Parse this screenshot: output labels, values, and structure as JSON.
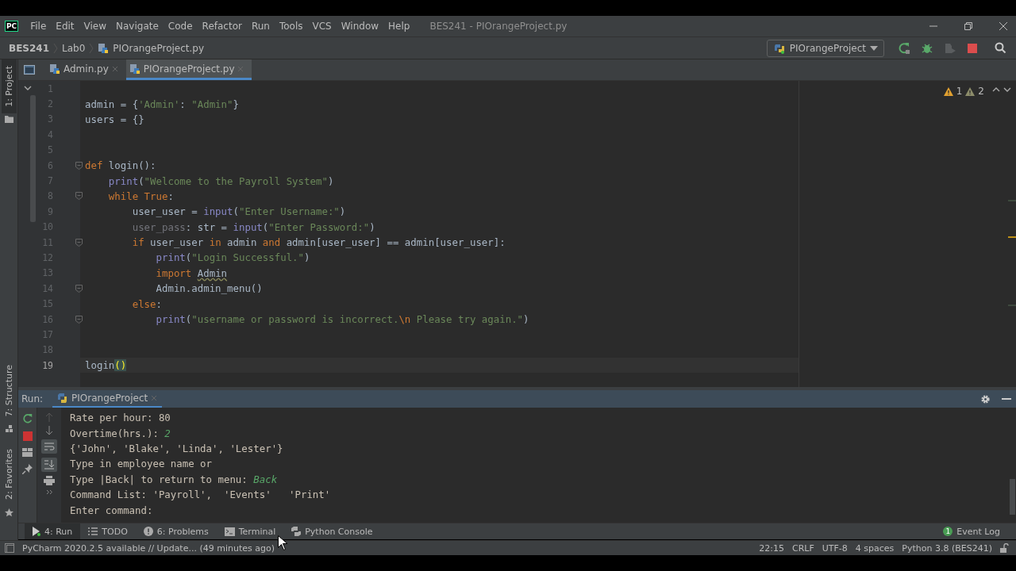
{
  "menu_bar": {
    "logo": "PC",
    "items": [
      "File",
      "Edit",
      "View",
      "Navigate",
      "Code",
      "Refactor",
      "Run",
      "Tools",
      "VCS",
      "Window",
      "Help"
    ],
    "title": "BES241 - PIOrangeProject.py"
  },
  "breadcrumbs": [
    "BES241",
    "Lab0",
    "PIOrangeProject.py"
  ],
  "run_config": {
    "label": "PIOrangeProject"
  },
  "side_tools": {
    "project": "1: Project",
    "structure": "7: Structure",
    "favorites": "2: Favorites"
  },
  "tabs": [
    {
      "label": "Admin.py",
      "selected": false
    },
    {
      "label": "PIOrangeProject.py",
      "selected": true
    }
  ],
  "inspections": {
    "warnings": "1",
    "weak_warnings": "2"
  },
  "editor": {
    "lines": [
      {
        "number": "1"
      },
      {
        "number": "2",
        "tokens": [
          {
            "kind": "plain",
            "text": "admin = {"
          },
          {
            "kind": "str",
            "text": "'Admin'"
          },
          {
            "kind": "plain",
            "text": ": "
          },
          {
            "kind": "str",
            "text": "\"Admin\""
          },
          {
            "kind": "plain",
            "text": "}"
          }
        ]
      },
      {
        "number": "3",
        "tokens": [
          {
            "kind": "plain",
            "text": "users = {}"
          }
        ]
      },
      {
        "number": "4"
      },
      {
        "number": "5"
      },
      {
        "number": "6",
        "fold": true,
        "tokens": [
          {
            "kind": "kw",
            "text": "def"
          },
          {
            "kind": "plain",
            "text": " login():"
          }
        ]
      },
      {
        "number": "7",
        "tokens": [
          {
            "kind": "builtin",
            "text": "    print"
          },
          {
            "kind": "plain",
            "text": "("
          },
          {
            "kind": "str",
            "text": "\"Welcome to the Payroll System\""
          },
          {
            "kind": "plain",
            "text": ")"
          }
        ]
      },
      {
        "number": "8",
        "fold": true,
        "tokens": [
          {
            "kind": "kw",
            "text": "    while True"
          },
          {
            "kind": "plain",
            "text": ":"
          }
        ]
      },
      {
        "number": "9",
        "tokens": [
          {
            "kind": "plain",
            "text": "        user_user = "
          },
          {
            "kind": "builtin",
            "text": "input"
          },
          {
            "kind": "plain",
            "text": "("
          },
          {
            "kind": "str",
            "text": "\"Enter Username:\""
          },
          {
            "kind": "plain",
            "text": ")"
          }
        ]
      },
      {
        "number": "10",
        "tokens": [
          {
            "kind": "dim",
            "text": "        user_pass"
          },
          {
            "kind": "plain",
            "text": ": str = "
          },
          {
            "kind": "builtin",
            "text": "input"
          },
          {
            "kind": "plain",
            "text": "("
          },
          {
            "kind": "str",
            "text": "\"Enter Password:\""
          },
          {
            "kind": "plain",
            "text": ")"
          }
        ]
      },
      {
        "number": "11",
        "fold": true,
        "tokens": [
          {
            "kind": "kw",
            "text": "        if"
          },
          {
            "kind": "plain",
            "text": " user_user "
          },
          {
            "kind": "kw",
            "text": "in"
          },
          {
            "kind": "plain",
            "text": " admin "
          },
          {
            "kind": "kw",
            "text": "and"
          },
          {
            "kind": "plain",
            "text": " admin[user_user] == admin[user_user]:"
          }
        ]
      },
      {
        "number": "12",
        "tokens": [
          {
            "kind": "builtin",
            "text": "            print"
          },
          {
            "kind": "plain",
            "text": "("
          },
          {
            "kind": "str",
            "text": "\"Login Successful.\""
          },
          {
            "kind": "plain",
            "text": ")"
          }
        ]
      },
      {
        "number": "13",
        "tokens": [
          {
            "kind": "kw",
            "text": "            import "
          },
          {
            "kind": "warn",
            "text": "Admin"
          }
        ]
      },
      {
        "number": "14",
        "fold": true,
        "tokens": [
          {
            "kind": "plain",
            "text": "            Admin.admin_menu()"
          }
        ]
      },
      {
        "number": "15",
        "tokens": [
          {
            "kind": "kw",
            "text": "        else"
          },
          {
            "kind": "plain",
            "text": ":"
          }
        ]
      },
      {
        "number": "16",
        "fold": true,
        "tokens": [
          {
            "kind": "builtin",
            "text": "            print"
          },
          {
            "kind": "plain",
            "text": "("
          },
          {
            "kind": "str",
            "text": "\"username or password is incorrect."
          },
          {
            "kind": "esc",
            "text": "\\n"
          },
          {
            "kind": "str",
            "text": " Please try again.\""
          },
          {
            "kind": "plain",
            "text": ")"
          }
        ]
      },
      {
        "number": "17"
      },
      {
        "number": "18"
      },
      {
        "number": "19",
        "current": true,
        "tokens": [
          {
            "kind": "plain",
            "text": "login"
          },
          {
            "kind": "match",
            "text": "()"
          }
        ]
      }
    ]
  },
  "run_panel": {
    "label": "Run:",
    "tab": "PIOrangeProject",
    "lines": [
      [
        {
          "kind": "plain",
          "text": "Rate per hour: 80"
        }
      ],
      [
        {
          "kind": "plain",
          "text": "Overtime(hrs.): "
        },
        {
          "kind": "input",
          "text": "2"
        }
      ],
      [
        {
          "kind": "plain",
          "text": "{'John', 'Blake', 'Linda', 'Lester'}"
        }
      ],
      [
        {
          "kind": "plain",
          "text": "Type in employee name or"
        }
      ],
      [
        {
          "kind": "plain",
          "text": "Type |Back| to return to menu: "
        },
        {
          "kind": "input",
          "text": "Back"
        }
      ],
      [
        {
          "kind": "plain",
          "text": "Command List: 'Payroll',  'Events'   'Print'"
        }
      ],
      [
        {
          "kind": "plain",
          "text": "Enter command:"
        }
      ]
    ]
  },
  "tool_windows": [
    {
      "kind": "run",
      "label": "4: Run",
      "selected": true
    },
    {
      "kind": "todo",
      "label": "TODO",
      "selected": false
    },
    {
      "kind": "problems",
      "label": "6: Problems",
      "selected": false
    },
    {
      "kind": "terminal",
      "label": "Terminal",
      "selected": false
    },
    {
      "kind": "python",
      "label": "Python Console",
      "selected": false
    }
  ],
  "event_log": {
    "count": "1",
    "label": "Event Log"
  },
  "status_bar": {
    "message": "PyCharm 2020.2.5 available // Update... (49 minutes ago)",
    "items": [
      "22:15",
      "CRLF",
      "UTF-8",
      "4 spaces",
      "Python 3.8 (BES241)"
    ]
  }
}
